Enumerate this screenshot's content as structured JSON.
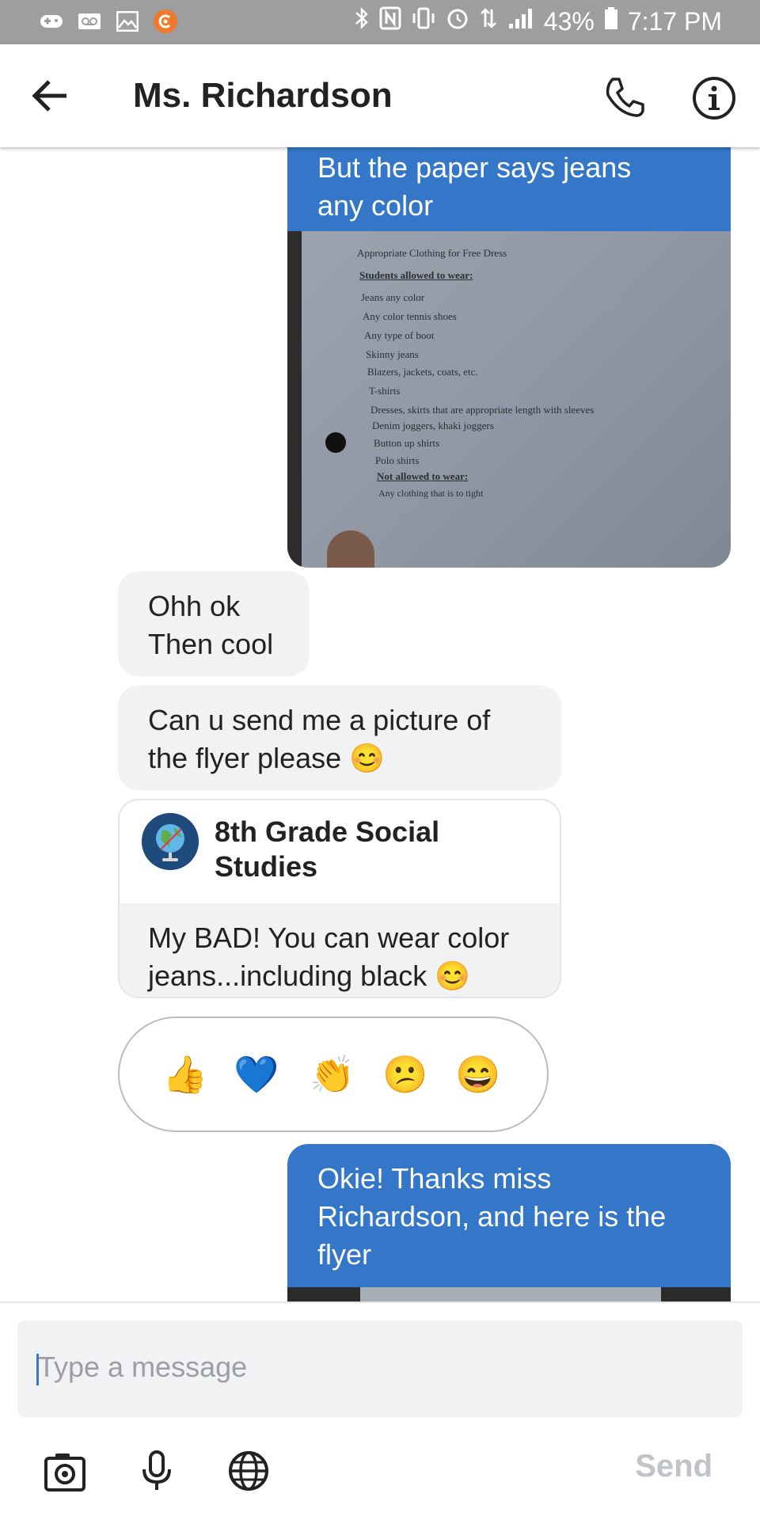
{
  "status_bar": {
    "battery": "43%",
    "time": "7:17 PM"
  },
  "header": {
    "title": "Ms. Richardson"
  },
  "messages": {
    "outgoing_1": {
      "lines": [
        "But the paper says jeans",
        "any color"
      ]
    },
    "photo_1": {
      "lines": [
        "Appropriate Clothing for Free Dress",
        "Students allowed to wear:",
        "Jeans any color",
        "Any color tennis shoes",
        "Any type of boot",
        "Skinny jeans",
        "Blazers, jackets, coats, etc.",
        "T-shirts",
        "Dresses, skirts that are appropriate length with sleeves",
        "Denim joggers, khaki joggers",
        "Button up shirts",
        "Polo shirts",
        "Not allowed to wear:",
        "Any clothing that is to tight"
      ]
    },
    "incoming_1": {
      "lines": [
        "Ohh ok",
        "Then cool"
      ]
    },
    "incoming_2": {
      "lines": [
        "Can u send me a picture of",
        "the flyer please 😊"
      ]
    },
    "card": {
      "title": "8th Grade Social Studies",
      "lines": [
        "My BAD! You can wear color",
        "jeans...including black 😊"
      ]
    },
    "reactions": [
      "👍",
      "💙",
      "👏",
      "😕",
      "😄"
    ],
    "outgoing_2": {
      "lines": [
        "Okie! Thanks miss",
        "Richardson, and here is the",
        "flyer"
      ]
    }
  },
  "composer": {
    "placeholder": "Type a message",
    "send_label": "Send"
  }
}
